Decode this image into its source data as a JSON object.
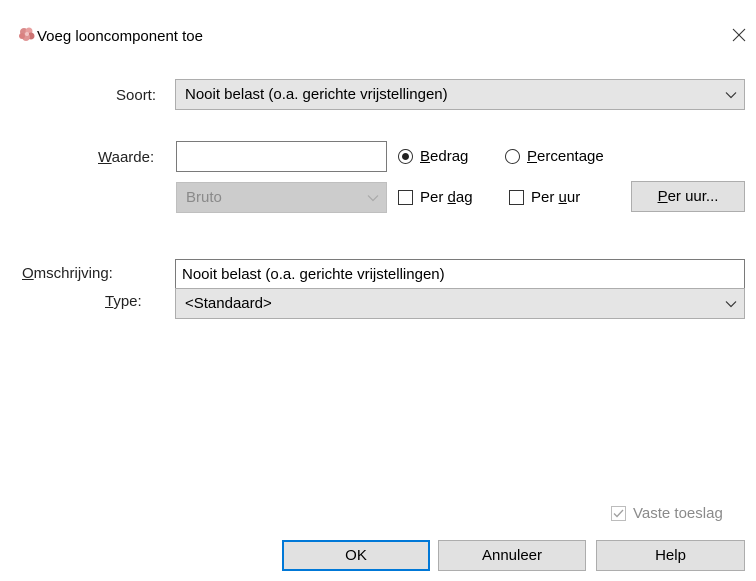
{
  "window": {
    "title": "Voeg looncomponent toe"
  },
  "form": {
    "soort_label": "Soort:",
    "soort_value": "Nooit belast (o.a. gerichte vrijstellingen)",
    "waarde_label": "Waarde:",
    "waarde_value": "",
    "bedrag_label": "Bedrag",
    "percentage_label": "Percentage",
    "bedrag_selected": true,
    "bruto_value": "Bruto",
    "per_dag_label": "Per dag",
    "per_uur_check_label": "Per uur",
    "per_uur_button_label": "Per uur...",
    "omschrijving_label": "Omschrijving:",
    "omschrijving_value": "Nooit belast (o.a. gerichte vrijstellingen)",
    "type_label": "Type:",
    "type_value": "<Standaard>",
    "vaste_toeslag_label": "Vaste toeslag",
    "vaste_toeslag_checked": true
  },
  "buttons": {
    "ok": "OK",
    "annuleer": "Annuleer",
    "help": "Help"
  },
  "colors": {
    "accent": "#0078d7",
    "combo_bg": "#e5e5e5",
    "button_bg": "#e1e1e1",
    "disabled_text": "#8a8a8a"
  }
}
